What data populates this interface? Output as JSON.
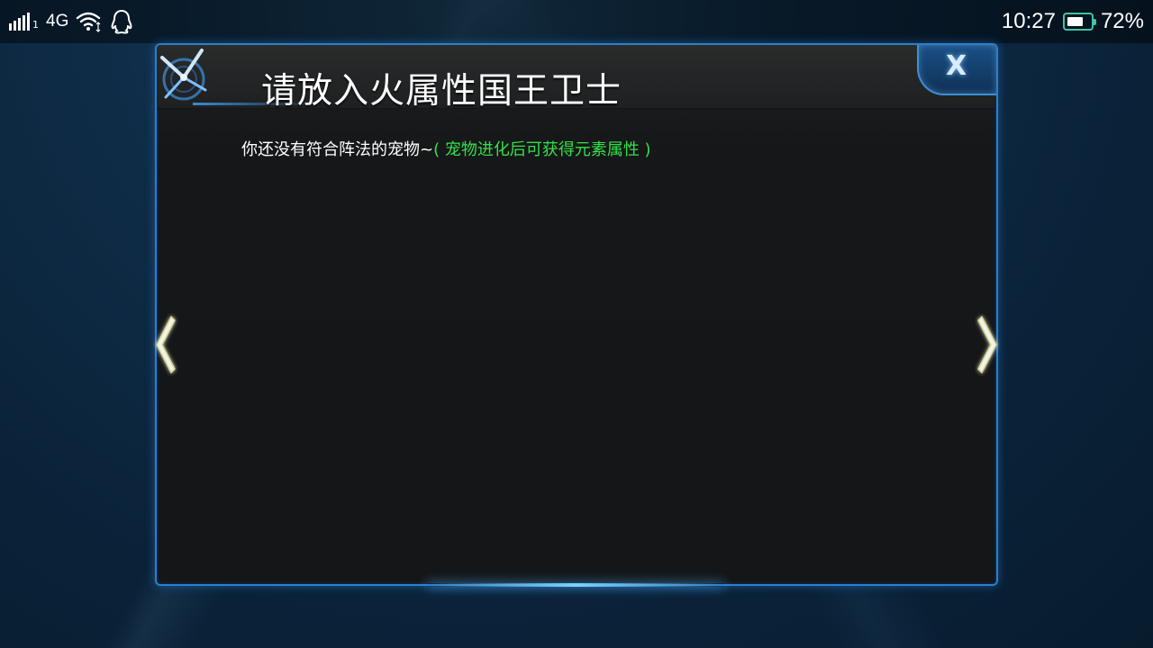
{
  "status_bar": {
    "network": "4G",
    "signal_sub": "1",
    "time": "10:27",
    "battery_percent_text": "72%",
    "battery_level": 0.72,
    "icons": [
      "signal-icon",
      "wifi-icon",
      "qq-icon",
      "battery-icon"
    ]
  },
  "dialog": {
    "title": "请放入火属性国王卫士",
    "message_white": "你还没有符合阵法的宠物~",
    "message_green": "( 宠物进化后可获得元素属性 )",
    "close_icon": "close-icon"
  },
  "navigation": {
    "prev_icon": "chevron-left-icon",
    "next_icon": "chevron-right-icon"
  },
  "colors": {
    "accent_blue": "#2e7fc9",
    "hint_green": "#35e04a",
    "battery_green": "#3ec6a0"
  }
}
